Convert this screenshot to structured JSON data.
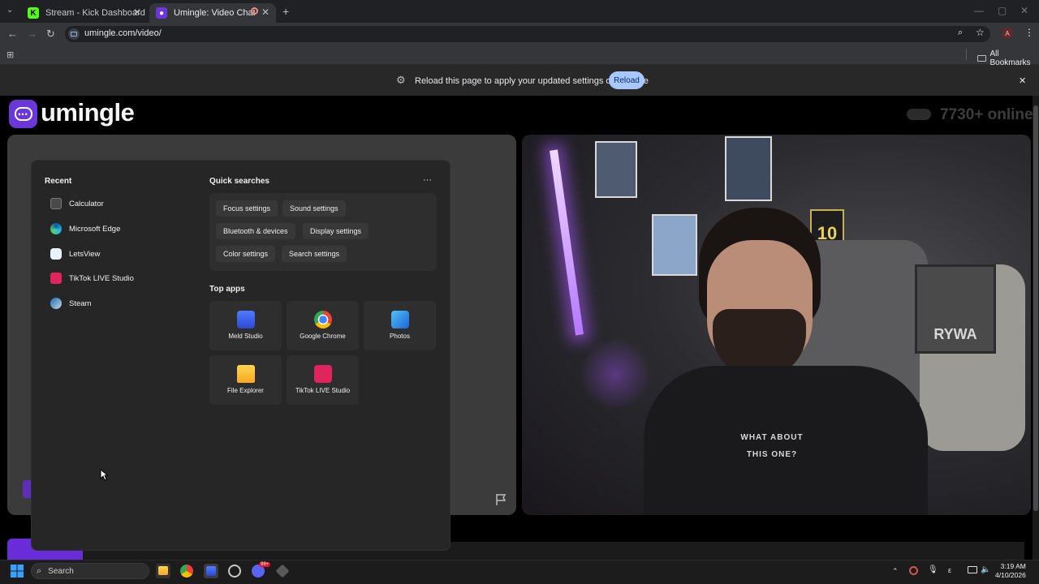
{
  "browser": {
    "tabs": [
      {
        "title": "Stream - Kick Dashboard",
        "active": false
      },
      {
        "title": "Umingle: Video Chat with S",
        "active": true
      }
    ],
    "url": "umingle.com/video/",
    "bookmarks_label": "All Bookmarks",
    "profile_initial": "A"
  },
  "infobar": {
    "text": "Reload this page to apply your updated settings on this site",
    "reload_label": "Reload"
  },
  "site": {
    "logo_text": "umingle",
    "online_text": "7730+ online"
  },
  "start_menu": {
    "recent_title": "Recent",
    "recent": [
      "Calculator",
      "Microsoft Edge",
      "LetsView",
      "TikTok LIVE Studio",
      "Steam"
    ],
    "quick_title": "Quick searches",
    "more": "···",
    "quick": [
      [
        "Focus settings",
        "Sound settings"
      ],
      [
        "Bluetooth & devices",
        "Display settings"
      ],
      [
        "Color settings",
        "Search settings"
      ]
    ],
    "top_apps_title": "Top apps",
    "top_apps": [
      "Meld Studio",
      "Google Chrome",
      "Photos",
      "File Explorer",
      "TikTok LIVE Studio"
    ]
  },
  "webcam": {
    "shirt_line1": "WHAT ABOUT",
    "shirt_line2": "THIS ONE?",
    "poster_text": "10",
    "poster_text2": "RYWA"
  },
  "taskbar": {
    "search_placeholder": "Search",
    "time": "3:19 AM",
    "date": "4/10/2026",
    "badge": "99+"
  },
  "colors": {
    "brand": "#6c37d9",
    "accent": "#a8c7fa"
  }
}
